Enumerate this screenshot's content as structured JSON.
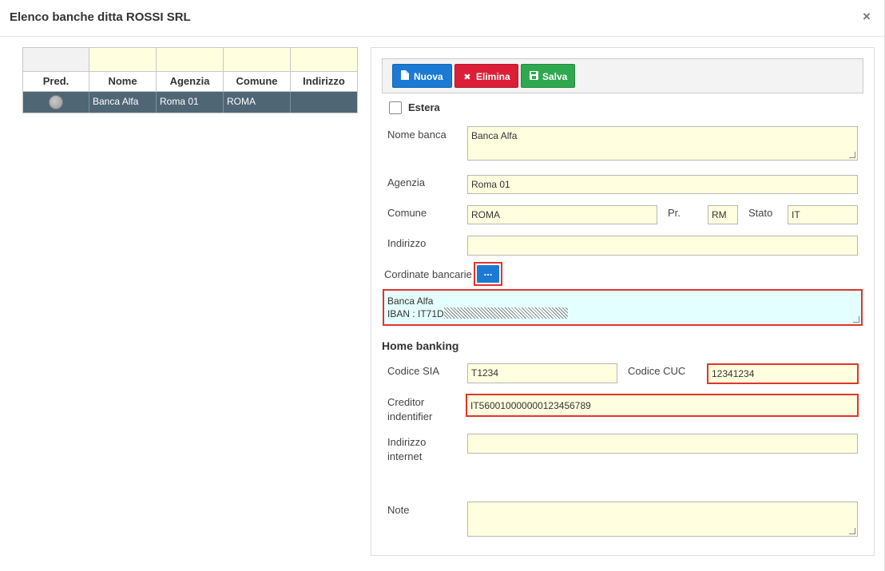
{
  "dialog": {
    "title": "Elenco banche ditta ROSSI SRL",
    "close_glyph": "×"
  },
  "grid": {
    "columns": [
      "Pred.",
      "Nome",
      "Agenzia",
      "Comune",
      "Indirizzo"
    ],
    "rows": [
      {
        "pred": true,
        "nome": "Banca Alfa",
        "agenzia": "Roma 01",
        "comune": "ROMA",
        "indirizzo": ""
      }
    ]
  },
  "toolbar": {
    "nuova_label": "Nuova",
    "elimina_label": "Elimina",
    "salva_label": "Salva",
    "nuova_color": "#1a7ad4",
    "elimina_color": "#dc1e37",
    "salva_color": "#2fa84f"
  },
  "form": {
    "estera_label": "Estera",
    "estera_checked": false,
    "nome_banca_label": "Nome banca",
    "nome_banca_value": "Banca Alfa",
    "agenzia_label": "Agenzia",
    "agenzia_value": "Roma 01",
    "comune_label": "Comune",
    "comune_value": "ROMA",
    "pr_label": "Pr.",
    "pr_value": "RM",
    "stato_label": "Stato",
    "stato_value": "IT",
    "indirizzo_label": "Indirizzo",
    "indirizzo_value": "",
    "coordinate_label": "Cordinate bancarie",
    "coordinate_button_label": "...",
    "coordinate_line1": "Banca Alfa",
    "coordinate_line2": "IBAN : IT71D",
    "home_banking_title": "Home banking",
    "codice_sia_label": "Codice SIA",
    "codice_sia_value": "T1234",
    "codice_cuc_label": "Codice CUC",
    "codice_cuc_value": "12341234",
    "creditor_label_1": "Creditor",
    "creditor_label_2": "indentifier",
    "creditor_value": "IT560010000000123456789",
    "indirizzo_internet_label_1": "Indirizzo",
    "indirizzo_internet_label_2": "internet",
    "indirizzo_internet_value": "",
    "note_label": "Note",
    "note_value": ""
  },
  "colors": {
    "field_bg": "#ffffe0",
    "highlight_border": "#e0352b",
    "selected_row": "#4f6675",
    "coordinate_bg": "#e3ffff"
  }
}
